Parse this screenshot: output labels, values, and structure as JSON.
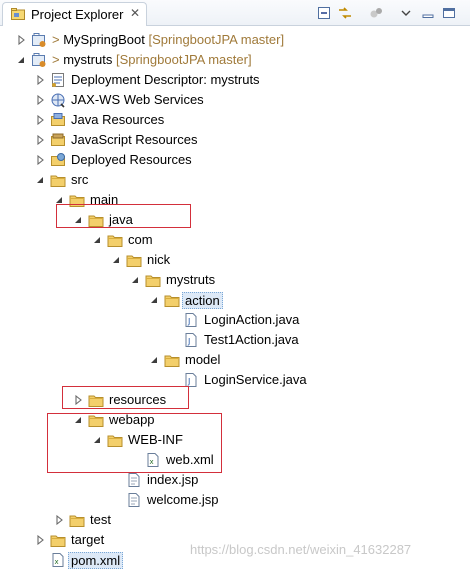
{
  "view": {
    "title": "Project Explorer",
    "close_glyph": "✕",
    "toolbar": [
      "collapse-all-icon",
      "link-with-editor-icon",
      "filter-icon",
      "view-menu-icon",
      "minimize-icon",
      "maximize-icon"
    ]
  },
  "tree": [
    {
      "label": "MySpringBoot",
      "decoration": "[SpringbootJPA master]",
      "prefix": "> ",
      "icon": "project-icon",
      "arrow": "collapsed",
      "level": 0
    },
    {
      "label": "mystruts",
      "decoration": "[SpringbootJPA master]",
      "prefix": "> ",
      "icon": "project-icon",
      "arrow": "expanded",
      "level": 0
    },
    {
      "label": "Deployment Descriptor: mystruts",
      "icon": "deployment-descriptor-icon",
      "arrow": "collapsed",
      "level": 1
    },
    {
      "label": "JAX-WS Web Services",
      "icon": "web-services-icon",
      "arrow": "collapsed",
      "level": 1
    },
    {
      "label": "Java Resources",
      "icon": "java-resources-icon",
      "arrow": "collapsed",
      "level": 1
    },
    {
      "label": "JavaScript Resources",
      "icon": "javascript-resources-icon",
      "arrow": "collapsed",
      "level": 1
    },
    {
      "label": "Deployed Resources",
      "icon": "deployed-resources-icon",
      "arrow": "collapsed",
      "level": 1
    },
    {
      "label": "src",
      "icon": "folder-icon",
      "arrow": "expanded",
      "level": 1
    },
    {
      "label": "main",
      "icon": "folder-icon",
      "arrow": "expanded",
      "level": 2
    },
    {
      "label": "java",
      "icon": "folder-icon",
      "arrow": "expanded",
      "level": 3
    },
    {
      "label": "com",
      "icon": "folder-icon",
      "arrow": "expanded",
      "level": 4
    },
    {
      "label": "nick",
      "icon": "folder-icon",
      "arrow": "expanded",
      "level": 5
    },
    {
      "label": "mystruts",
      "icon": "folder-icon",
      "arrow": "expanded",
      "level": 6
    },
    {
      "label": "action",
      "icon": "folder-icon",
      "arrow": "expanded",
      "level": 7,
      "selected": true
    },
    {
      "label": "LoginAction.java",
      "icon": "java-file-icon",
      "arrow": "none",
      "level": 8
    },
    {
      "label": "Test1Action.java",
      "icon": "java-file-icon",
      "arrow": "none",
      "level": 8
    },
    {
      "label": "model",
      "icon": "folder-icon",
      "arrow": "expanded",
      "level": 7
    },
    {
      "label": "LoginService.java",
      "icon": "java-file-icon",
      "arrow": "none",
      "level": 8
    },
    {
      "label": "resources",
      "icon": "folder-icon",
      "arrow": "collapsed",
      "level": 3
    },
    {
      "label": "webapp",
      "icon": "folder-icon",
      "arrow": "expanded",
      "level": 3
    },
    {
      "label": "WEB-INF",
      "icon": "folder-icon",
      "arrow": "expanded",
      "level": 4
    },
    {
      "label": "web.xml",
      "icon": "xml-file-icon",
      "arrow": "none",
      "level": 6
    },
    {
      "label": "index.jsp",
      "icon": "jsp-file-icon",
      "arrow": "none",
      "level": 5
    },
    {
      "label": "welcome.jsp",
      "icon": "jsp-file-icon",
      "arrow": "none",
      "level": 5
    },
    {
      "label": "test",
      "icon": "folder-icon",
      "arrow": "collapsed",
      "level": 2
    },
    {
      "label": "target",
      "icon": "folder-icon",
      "arrow": "collapsed",
      "level": 1
    },
    {
      "label": "pom.xml",
      "icon": "xml-file-icon",
      "arrow": "none",
      "level": 1,
      "selected": true
    }
  ],
  "watermark": "https://blog.csdn.net/weixin_41632287",
  "colors": {
    "highlight_box": "#d32f3b",
    "decoration": "#a07a3a",
    "selection": "#dde9f7"
  }
}
